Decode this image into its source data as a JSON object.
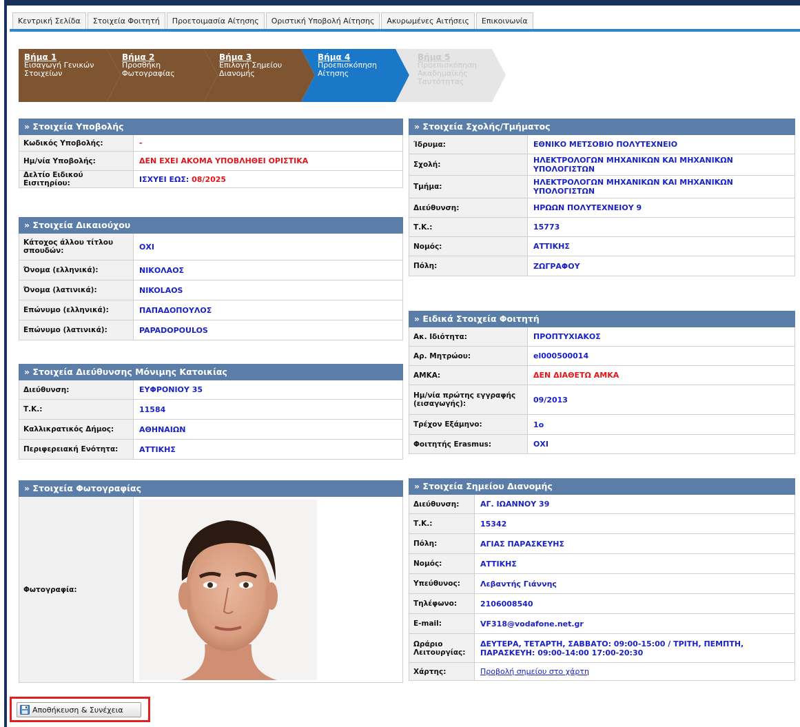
{
  "tabs": [
    "Κεντρική Σελίδα",
    "Στοιχεία Φοιτητή",
    "Προετοιμασία Αίτησης",
    "Οριστική Υποβολή Αίτησης",
    "Ακυρωμένες Αιτήσεις",
    "Επικοινωνία"
  ],
  "steps": [
    {
      "num": "Βήμα 1",
      "label": "Εισαγωγή Γενικών\nΣτοιχείων",
      "state": "done"
    },
    {
      "num": "Βήμα 2",
      "label": "Προσθήκη\nΦωτογραφίας",
      "state": "done"
    },
    {
      "num": "Βήμα 3",
      "label": "Επιλογή Σημείου\nΔιανομής",
      "state": "done"
    },
    {
      "num": "Βήμα 4",
      "label": "Προεπισκόπηση\nΑίτησης",
      "state": "current"
    },
    {
      "num": "Βήμα 5",
      "label": "Προεπισκόπηση\nΑκαδημαϊκής\nΤαυτότητας",
      "state": "pending"
    }
  ],
  "colors": {
    "done": "#7e5530",
    "current": "#1b78c8",
    "pending": "#e4e4e4",
    "header": "#5b7ea8",
    "value": "#1a22c4",
    "error": "#e3151a"
  },
  "submission": {
    "title": "» Στοιχεία Υποβολής",
    "rows": [
      {
        "k": "Κωδικός Υποβολής:",
        "v": "-"
      },
      {
        "k": "Ημ/νία Υποβολής:",
        "v": "ΔΕΝ ΕΧΕΙ ΑΚΟΜΑ ΥΠΟΒΛΗΘΕΙ ΟΡΙΣΤΙΚΑ"
      },
      {
        "k": "Δελτίο Ειδικού Εισιτηρίου:",
        "v_prefix": "ΙΣΧΥΕΙ ΕΩΣ:",
        "v_date": "08/2025"
      }
    ]
  },
  "beneficiary": {
    "title": "» Στοιχεία Δικαιούχου",
    "rows": [
      {
        "k": "Κάτοχος άλλου τίτλου σπουδών:",
        "v": "ΟΧΙ"
      },
      {
        "k": "Όνομα (ελληνικά):",
        "v": "ΝΙΚΟΛΑΟΣ"
      },
      {
        "k": "Όνομα (λατινικά):",
        "v": "NIKOLAOS"
      },
      {
        "k": "Επώνυμο (ελληνικά):",
        "v": "ΠΑΠΑΔΟΠΟΥΛΟΣ"
      },
      {
        "k": "Επώνυμο (λατινικά):",
        "v": "PAPADOPOULOS"
      }
    ]
  },
  "residence": {
    "title": "» Στοιχεία Διεύθυνσης Μόνιμης Κατοικίας",
    "rows": [
      {
        "k": "Διεύθυνση:",
        "v": "ΕΥΦΡΟΝΙΟΥ 35"
      },
      {
        "k": "Τ.Κ.:",
        "v": "11584"
      },
      {
        "k": "Καλλικρατικός Δήμος:",
        "v": "ΑΘΗΝΑΙΩΝ"
      },
      {
        "k": "Περιφερειακή Ενότητα:",
        "v": "ΑΤΤΙΚΗΣ"
      }
    ]
  },
  "photo": {
    "title": "» Στοιχεία Φωτογραφίας",
    "label": "Φωτογραφία:"
  },
  "school": {
    "title": "» Στοιχεία Σχολής/Τμήματος",
    "rows": [
      {
        "k": "Ίδρυμα:",
        "v": "ΕΘΝΙΚΟ ΜΕΤΣΟΒΙΟ ΠΟΛΥΤΕΧΝΕΙΟ"
      },
      {
        "k": "Σχολή:",
        "v": "ΗΛΕΚΤΡΟΛΟΓΩΝ ΜΗΧΑΝΙΚΩΝ ΚΑΙ ΜΗΧΑΝΙΚΩΝ ΥΠΟΛΟΓΙΣΤΩΝ"
      },
      {
        "k": "Τμήμα:",
        "v": "ΗΛΕΚΤΡΟΛΟΓΩΝ ΜΗΧΑΝΙΚΩΝ ΚΑΙ ΜΗΧΑΝΙΚΩΝ ΥΠΟΛΟΓΙΣΤΩΝ"
      },
      {
        "k": "Διεύθυνση:",
        "v": "ΗΡΩΩΝ ΠΟΛΥΤΕΧΝΕΙΟΥ 9"
      },
      {
        "k": "Τ.Κ.:",
        "v": "15773"
      },
      {
        "k": "Νομός:",
        "v": "ΑΤΤΙΚΗΣ"
      },
      {
        "k": "Πόλη:",
        "v": "ΖΩΓΡΑΦΟΥ"
      }
    ]
  },
  "special": {
    "title": "» Ειδικά Στοιχεία Φοιτητή",
    "rows": [
      {
        "k": "Ακ. Ιδιότητα:",
        "v": "ΠΡΟΠΤΥΧΙΑΚΟΣ"
      },
      {
        "k": "Αρ. Μητρώου:",
        "v": "el000500014"
      },
      {
        "k": "ΑΜΚΑ:",
        "v": "ΔΕΝ ΔΙΑΘΕΤΩ ΑΜΚΑ"
      },
      {
        "k": "Ημ/νία πρώτης εγγραφής (εισαγωγής):",
        "v": "09/2013"
      },
      {
        "k": "Τρέχον Εξάμηνο:",
        "v": "1ο"
      },
      {
        "k": "Φοιτητής Erasmus:",
        "v": "ΟΧΙ"
      }
    ]
  },
  "delivery": {
    "title": "» Στοιχεία Σημείου Διανομής",
    "rows": [
      {
        "k": "Διεύθυνση:",
        "v": "ΑΓ. ΙΩΑΝΝΟΥ 39"
      },
      {
        "k": "Τ.Κ.:",
        "v": "15342"
      },
      {
        "k": "Πόλη:",
        "v": "ΑΓΙΑΣ ΠΑΡΑΣΚΕΥΗΣ"
      },
      {
        "k": "Νομός:",
        "v": "ΑΤΤΙΚΗΣ"
      },
      {
        "k": "Υπεύθυνος:",
        "v": "Λεβαντής Γιάννης"
      },
      {
        "k": "Τηλέφωνο:",
        "v": "2106008540"
      },
      {
        "k": "E-mail:",
        "v": "VF318@vodafone.net.gr"
      },
      {
        "k": "Ωράριο Λειτουργίας:",
        "v": "ΔΕΥΤΕΡΑ, ΤΕΤΑΡΤΗ, ΣΑΒΒΑΤΟ: 09:00-15:00 / ΤΡΙΤΗ, ΠΕΜΠΤΗ, ΠΑΡΑΣΚΕΥΗ: 09:00-14:00 17:00-20:30"
      },
      {
        "k": "Χάρτης:",
        "v": "Προβολή σημείου στο χάρτη"
      }
    ]
  },
  "save_button": "Αποθήκευση & Συνέχεια"
}
